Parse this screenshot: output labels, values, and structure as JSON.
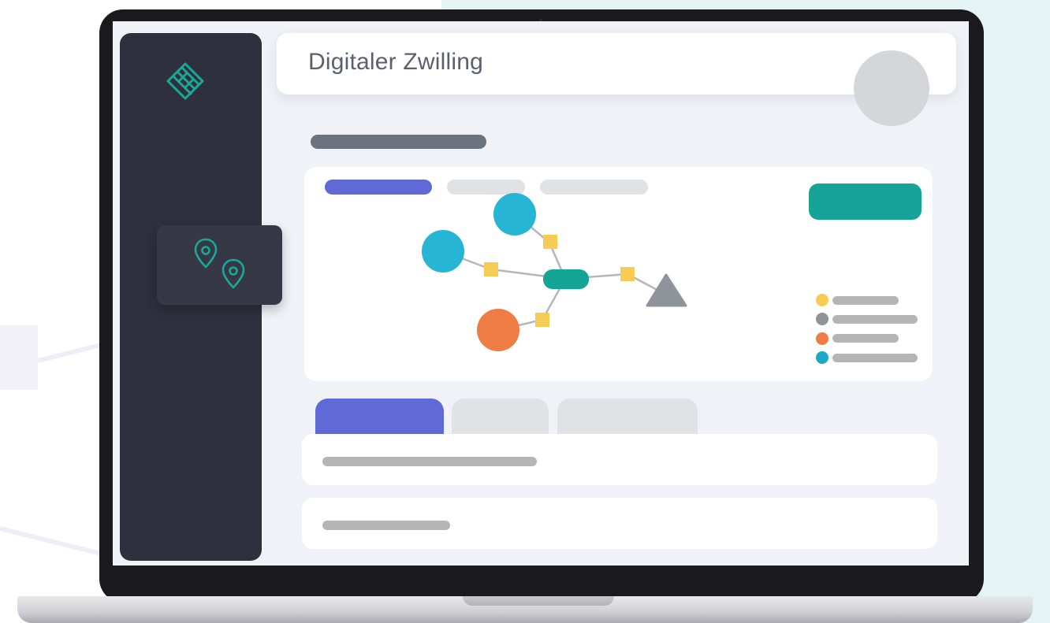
{
  "header": {
    "title": "Digitaler Zwilling"
  },
  "sidebar": {
    "logo_icon": "cube-network-logo-icon",
    "active_item_icon": "location-pins-icon"
  },
  "graph": {
    "legend_colors": [
      "#f6cc55",
      "#8e9499",
      "#ef7c45",
      "#1ea8c8"
    ],
    "node_colors": {
      "blue": "#27b5d6",
      "orange": "#ef7c45",
      "hub": "#14a596",
      "link": "#f6cc55",
      "triangle": "#8e9499"
    }
  },
  "colors": {
    "accent": "#5f6ad6",
    "primary_button": "#17a398",
    "sidebar": "#2e303d"
  }
}
